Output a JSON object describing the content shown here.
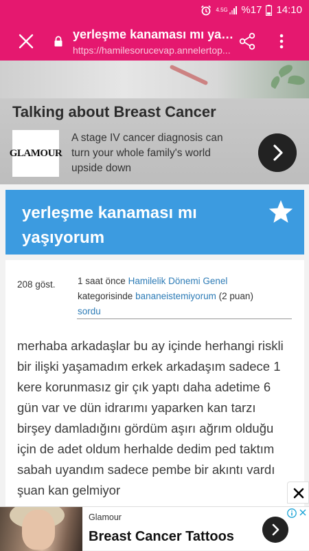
{
  "status": {
    "time": "14:10",
    "battery": "%17",
    "network": "4.5G"
  },
  "toolbar": {
    "title": "yerleşme kanaması mı yaş...",
    "url": "https://hamilesorucevap.annelertop..."
  },
  "ad_top": {
    "headline": "Talking about Breast Cancer",
    "logo_text": "GLAMOUR",
    "description": "A stage IV cancer diagnosis can turn your whole family's world upside down"
  },
  "question": {
    "title": "yerleşme kanaması mı yaşıyorum",
    "views": "208 göst.",
    "time_ago": "1 saat önce",
    "category": "Hamilelik Dönemi Genel",
    "category_suffix": "kategorisinde",
    "user": "bananeistemiyorum",
    "points": "(2 puan)",
    "asked": "sordu",
    "body": "merhaba arkadaşlar bu ay içinde herhangi riskli bir ilişki yaşamadım erkek arkadaşım sadece 1 kere korunmasız gir çık yaptı daha adetime 6 gün var ve dün idrarımı yaparken kan tarzı birşey damladığını gördüm aşırı ağrım olduğu için de adet oldum herhalde dedim ped taktım sabah uyandım sadece pembe bir akıntı vardı şuan kan gelmiyor"
  },
  "ad_bottom": {
    "brand": "Glamour",
    "title": "Breast Cancer Tattoos"
  },
  "colors": {
    "toolbar": "#e5186f",
    "question_header": "#3c9be0",
    "link": "#2c7bb6"
  }
}
